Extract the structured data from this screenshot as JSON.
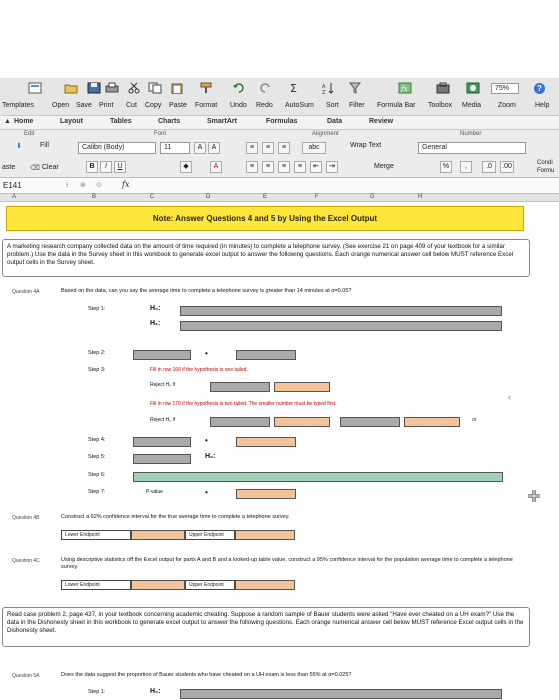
{
  "zoom": "75%",
  "toolbar": {
    "items": [
      "Templates",
      "Open",
      "Save",
      "Print",
      "Cut",
      "Copy",
      "Paste",
      "Format",
      "Undo",
      "Redo",
      "AutoSum",
      "Sort",
      "Filter",
      "Formula Bar",
      "Toolbox",
      "Media",
      "Zoom",
      "Help"
    ]
  },
  "ribbon_tabs": [
    "Home",
    "Layout",
    "Tables",
    "Charts",
    "SmartArt",
    "Formulas",
    "Data",
    "Review"
  ],
  "ribbon": {
    "groups": [
      "Edit",
      "Font",
      "Alignment",
      "Number"
    ],
    "fill": "Fill",
    "clear": "Clear",
    "paste": "aste",
    "font_name": "Calibri (Body)",
    "font_size": "11",
    "wrap_text": "Wrap Text",
    "merge": "Merge",
    "number_format": "General",
    "percent": "%",
    "comma": ",",
    "cond": "Condi",
    "cond2": "Formu",
    "abc": "abc"
  },
  "formula_bar": {
    "cell": "E141",
    "fx": "fx"
  },
  "columns": [
    "A",
    "B",
    "C",
    "D",
    "E",
    "F",
    "G",
    "H"
  ],
  "sheet": {
    "note": "Note: Answer Questions 4 and 5 by Using the Excel Output",
    "para1": "A marketing research company collected data on the amount of time required (in minutes) to complete a telephone survey. (See exercise 21 on page 409 of your textbook for a similar problem.) Use the data in the Survey sheet in this workbook to generate excel output to answer the following questions. Each orange numerical answer cell below MUST reference Excel output cells in the Survey sheet.",
    "q4a_label": "Question 4A",
    "q4a_text": "Based on the data, can you say the average time to complete a telephone survey is greater than 14 minutes at α=0.05?",
    "step1": "Step 1:",
    "h0": "H₀:",
    "h1": "H₁:",
    "step2": "Step 2:",
    "step3": "Step 3:",
    "fill_one_tailed": "Fill in row 166 if the hypothesis is one tailed.",
    "reject_one": "Reject H₀ if",
    "fill_two_tailed": "Fill in row 170 if the hypothesis is two tailed. The smaller number must be typed first.",
    "reject_two": "Reject H₀ if",
    "or": "or",
    "step4": "Step 4:",
    "step5": "Step 5:",
    "step6": "Step 6:",
    "step7": "Step 7:",
    "p_value": "P-value",
    "q4b_label": "Question 4B",
    "q4b_text": "Construct a 92% confidence interval for the true average time to complete a telephone survey.",
    "lower_endpoint": "Lower Endpoint",
    "upper_endpoint": "Upper Endpoint",
    "q4c_label": "Question 4C",
    "q4c_text": "Using descriptive statistics off the Excel output for parts A and B and a looked-up table value, construct a 95% confidence interval for the population average time to complete a telephone survey.",
    "para2": "Read case problem 2, page 437, in your textbook concerning academic cheating. Suppose a random sample of Bauer students were asked \"Have ever cheated on a UH exam?\" Use the data in the Dishonesty sheet in this workbook to generate excel output to answer the following questions. Each orange numerical answer cell below MUST reference Excel output cells in the Dishonesty sheet.",
    "q5a_label": "Question 5A",
    "q5a_text": "Does the data suggest the proportion of Bauer students who have cheated on a UH exam is less than 55% at α=0.025?",
    "step1b": "Step 1:",
    "h0b": "H₀:"
  }
}
